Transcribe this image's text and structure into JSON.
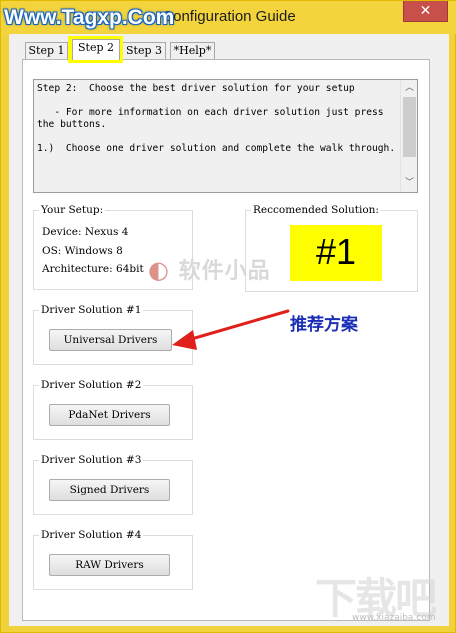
{
  "window": {
    "title": "Configuration Guide",
    "close_glyph": "✕"
  },
  "watermarks": {
    "top": "Www.Tagxp.Com",
    "middle": "软件小品",
    "bottom_logo": "下载吧",
    "bottom_url": "www.xiazaiba.com"
  },
  "tabs": [
    {
      "label": "Step 1",
      "active": false
    },
    {
      "label": "Step 2",
      "active": true
    },
    {
      "label": "Step 3",
      "active": false
    },
    {
      "label": "*Help*",
      "active": false
    }
  ],
  "instructions": {
    "text": "Step 2:  Choose the best driver solution for your setup\n\n   - For more information on each driver solution just press the buttons.\n\n1.)  Choose one driver solution and complete the walk through."
  },
  "setup": {
    "label": "Your Setup:",
    "device": "Device: Nexus 4",
    "os": "OS: Windows 8",
    "architecture": "Architecture: 64bit"
  },
  "recommended": {
    "label": "Reccomended Solution:",
    "value": "#1"
  },
  "annotation": {
    "text": "推荐方案",
    "color": "#1b2fb6",
    "arrow_color": "#e0201a"
  },
  "solutions": [
    {
      "label": "Driver Solution #1",
      "button": "Universal Drivers"
    },
    {
      "label": "Driver Solution #2",
      "button": "PdaNet Drivers"
    },
    {
      "label": "Driver Solution #3",
      "button": "Signed Drivers"
    },
    {
      "label": "Driver Solution #4",
      "button": "RAW Drivers"
    }
  ],
  "colors": {
    "frame": "#f2d23a",
    "highlight": "#ffff00",
    "close_button": "#c7504a"
  },
  "icons": {
    "close": "close-icon",
    "scroll_up": "chevron-up-icon",
    "scroll_down": "chevron-down-icon"
  }
}
